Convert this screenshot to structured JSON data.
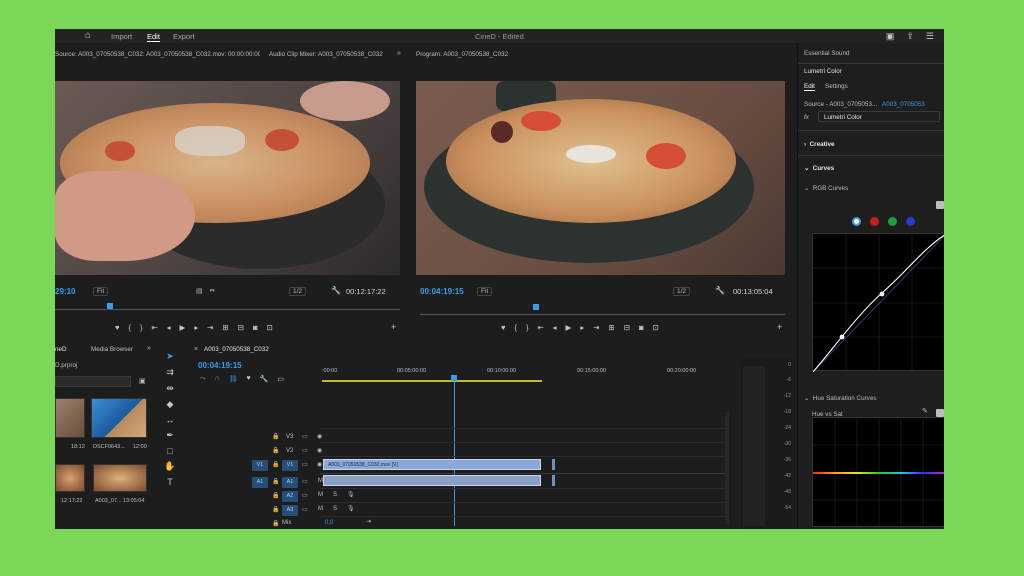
{
  "app": {
    "title": "CineD - Edited",
    "menu": [
      "Import",
      "Edit",
      "Export"
    ],
    "active_menu": "Edit"
  },
  "source_monitor": {
    "tab": "Source: A003_07050538_C032: A003_07050538_C032.mov: 00:00:00:00",
    "tab2": "Audio Clip Mixer: A003_07050538_C032",
    "timecode": "29:10",
    "fit": "Fit",
    "zoom": "1/2",
    "duration": "00:12:17:22"
  },
  "program_monitor": {
    "tab": "Program: A003_07050538_C032",
    "timecode": "00:04:19:15",
    "fit": "Fit",
    "zoom": "1/2",
    "duration": "00:13:05:04"
  },
  "project": {
    "tab": "neD",
    "tab2": "Media Browser",
    "file": "D.prproj",
    "clips": [
      {
        "name": "",
        "dur": "18:12"
      },
      {
        "name": "DSCF0643...",
        "dur": "12:00"
      },
      {
        "name": "",
        "dur": "12:17:22"
      },
      {
        "name": "A003_07...",
        "dur": "13:05:04"
      }
    ]
  },
  "timeline": {
    "sequence": "A003_07050538_C032",
    "timecode": "00:04:19:15",
    "ruler": [
      ":00:00",
      "00:05:00:00",
      "00:10:00:00",
      "00:15:00:00",
      "00:20:00:00"
    ],
    "video_tracks": [
      "V3",
      "V2",
      "V1"
    ],
    "audio_tracks": [
      "A1",
      "A2",
      "A3"
    ],
    "mix_label": "Mix",
    "mix_value": "0,0",
    "clip_name": "A003_07050538_C032.mov [V]",
    "meter_levels": [
      "0",
      "-6",
      "-12",
      "-18",
      "-24",
      "-30",
      "-36",
      "-42",
      "-48",
      "-54"
    ]
  },
  "lumetri": {
    "essential_sound": "Essential Sound",
    "panel": "Lumetri Color",
    "tabs": [
      "Edit",
      "Settings"
    ],
    "source": "Source - A003_0705053...",
    "source_target": "A003_0705053",
    "effect": "Lumetri Color",
    "sections": {
      "creative": "Creative",
      "curves": "Curves",
      "rgb_curves": "RGB Curves",
      "hue_sat_curves": "Hue Saturation Curves",
      "hue_vs_sat": "Hue vs Sat"
    },
    "channel_colors": [
      "#ffffff",
      "#c81e1e",
      "#1e9e3a",
      "#2a3ad0"
    ]
  },
  "colors": {
    "accent": "#3d9ce8",
    "background": "#7bd757"
  }
}
